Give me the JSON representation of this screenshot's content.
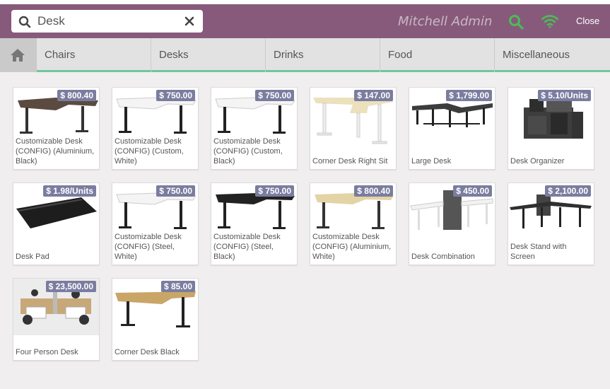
{
  "search": {
    "value": "Desk"
  },
  "header": {
    "user": "Mitchell Admin",
    "close_label": "Close"
  },
  "categories": [
    "Chairs",
    "Desks",
    "Drinks",
    "Food",
    "Miscellaneous"
  ],
  "products": [
    {
      "name": "Customizable Desk (CONFIG) (Aluminium, Black)",
      "price": "$ 800.40",
      "img": "desk-dark"
    },
    {
      "name": "Customizable Desk (CONFIG) (Custom, White)",
      "price": "$ 750.00",
      "img": "desk-white"
    },
    {
      "name": "Customizable Desk (CONFIG) (Custom, Black)",
      "price": "$ 750.00",
      "img": "desk-white"
    },
    {
      "name": "Corner Desk Right Sit",
      "price": "$ 147.00",
      "img": "desk-corner-light"
    },
    {
      "name": "Large Desk",
      "price": "$ 1,799.00",
      "img": "desk-large"
    },
    {
      "name": "Desk Organizer",
      "price": "$ 5.10/Units",
      "img": "organizer"
    },
    {
      "name": "Desk Pad",
      "price": "$ 1.98/Units",
      "img": "pad"
    },
    {
      "name": "Customizable Desk (CONFIG) (Steel, White)",
      "price": "$ 750.00",
      "img": "desk-white"
    },
    {
      "name": "Customizable Desk (CONFIG) (Steel, Black)",
      "price": "$ 750.00",
      "img": "desk-black"
    },
    {
      "name": "Customizable Desk (CONFIG) (Aluminium, White)",
      "price": "$ 800.40",
      "img": "desk-wood"
    },
    {
      "name": "Desk Combination",
      "price": "$ 450.00",
      "img": "combination"
    },
    {
      "name": "Desk Stand with Screen",
      "price": "$ 2,100.00",
      "img": "stand-screen"
    },
    {
      "name": "Four Person Desk",
      "price": "$ 23,500.00",
      "img": "four-person"
    },
    {
      "name": "Corner Desk Black",
      "price": "$ 85.00",
      "img": "desk-corner-wood"
    }
  ],
  "colors": {
    "header": "#875a7b",
    "accent": "#6ec89b",
    "price_badge": "#7a7d9f"
  }
}
